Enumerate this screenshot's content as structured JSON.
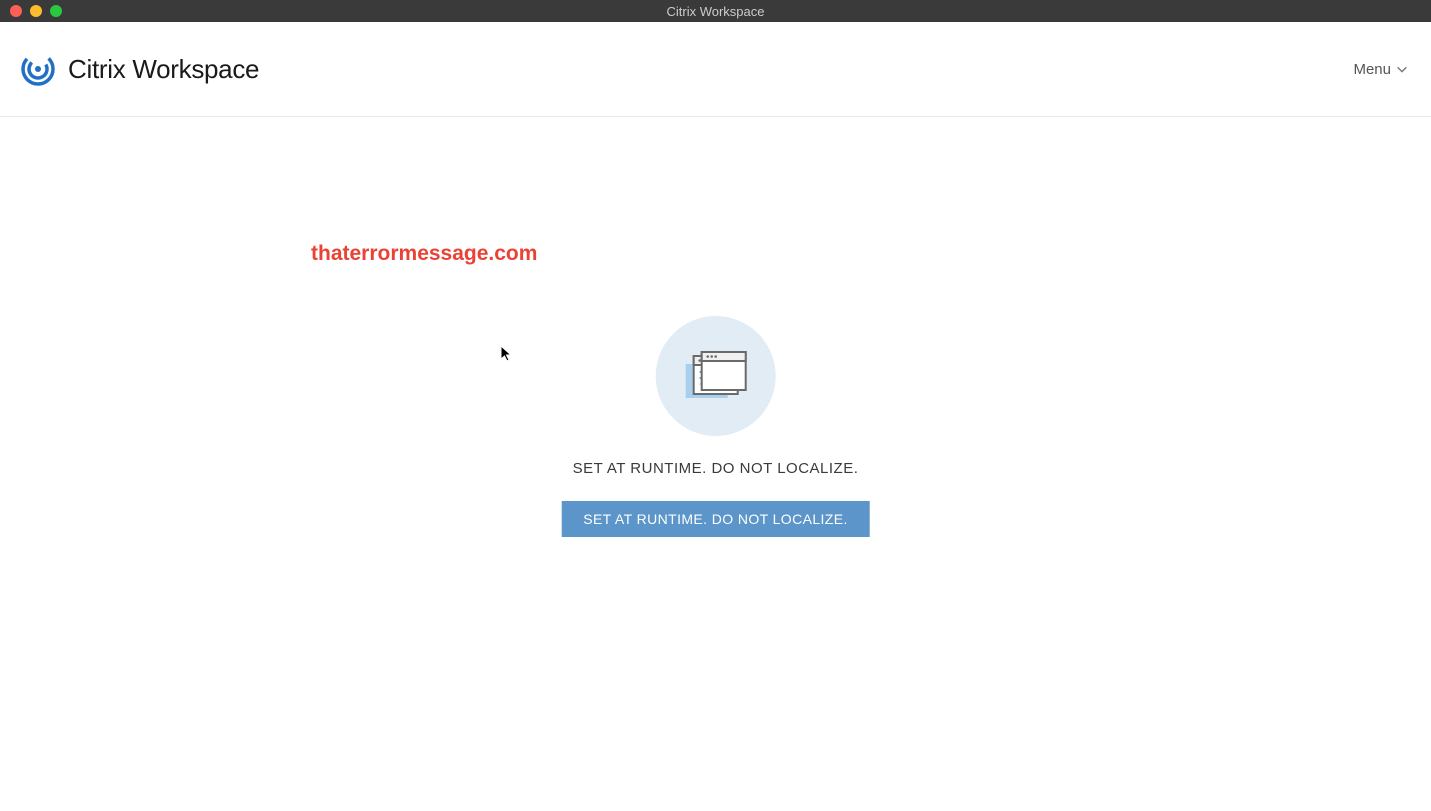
{
  "titlebar": {
    "title": "Citrix Workspace"
  },
  "header": {
    "brand_text": "Citrix Workspace",
    "menu_label": "Menu"
  },
  "watermark": {
    "text": "thaterrormessage.com"
  },
  "content": {
    "message": "SET AT RUNTIME. DO NOT LOCALIZE.",
    "button_label": "SET AT RUNTIME. DO NOT LOCALIZE."
  },
  "colors": {
    "accent": "#5b95c9",
    "brand_blue": "#2071c5",
    "watermark_red": "#ea4335"
  }
}
